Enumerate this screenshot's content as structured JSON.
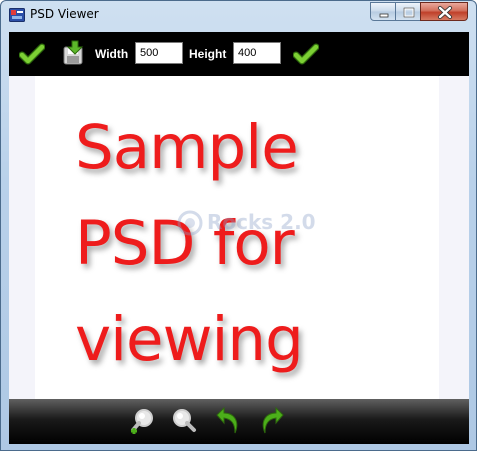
{
  "window": {
    "title": "PSD Viewer"
  },
  "titlebar": {
    "buttons": [
      "minimize",
      "maximize",
      "close"
    ]
  },
  "toolbar": {
    "icons": [
      "check-icon",
      "save-icon"
    ],
    "width_label": "Width",
    "width_value": "500",
    "height_label": "Height",
    "height_value": "400",
    "apply_icon": "check-icon"
  },
  "canvas": {
    "psd_lines": [
      "Sample",
      "PSD for",
      "viewing"
    ],
    "psd_text_color": "#ee1c1c",
    "watermark_logo_text": "Rocks 2.0"
  },
  "bottombar": {
    "icons": [
      "zoom-in-icon",
      "zoom-out-icon",
      "rotate-left-icon",
      "rotate-right-icon"
    ]
  },
  "colors": {
    "toolbar_bg": "#000000",
    "check_green": "#4caf1a",
    "titlebar": "#b9d1ea",
    "close_button": "#c0402a"
  }
}
